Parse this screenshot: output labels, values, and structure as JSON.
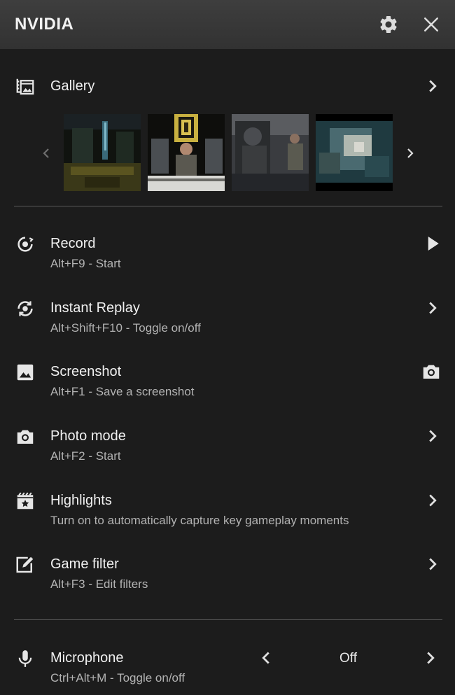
{
  "header": {
    "title": "NVIDIA"
  },
  "gallery": {
    "label": "Gallery"
  },
  "items": [
    {
      "title": "Record",
      "shortcut": "Alt+F9 - Start"
    },
    {
      "title": "Instant Replay",
      "shortcut": "Alt+Shift+F10 - Toggle on/off"
    },
    {
      "title": "Screenshot",
      "shortcut": "Alt+F1 - Save a screenshot"
    },
    {
      "title": "Photo mode",
      "shortcut": "Alt+F2 - Start"
    },
    {
      "title": "Highlights",
      "shortcut": "Turn on to automatically capture key gameplay moments"
    },
    {
      "title": "Game filter",
      "shortcut": "Alt+F3 - Edit filters"
    }
  ],
  "microphone": {
    "title": "Microphone",
    "shortcut": "Ctrl+Alt+M - Toggle on/off",
    "value": "Off"
  },
  "colors": {
    "background": "#1c1c1c",
    "header": "#363636",
    "text": "#f0f0f0",
    "subtext": "#b3b3b3",
    "divider": "#5a5a5a"
  }
}
